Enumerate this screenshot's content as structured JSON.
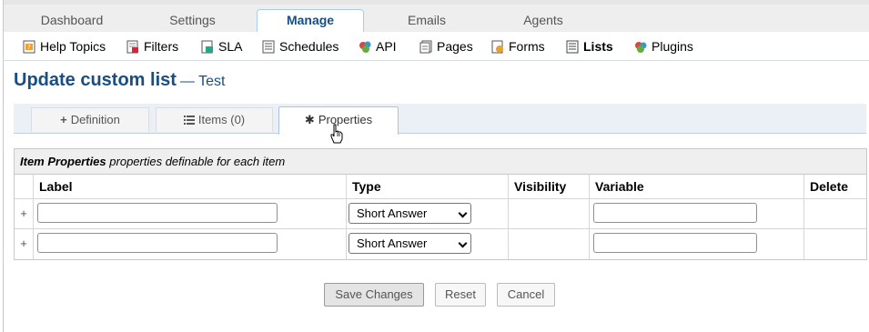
{
  "top_tabs": [
    {
      "label": "Dashboard"
    },
    {
      "label": "Settings"
    },
    {
      "label": "Manage",
      "active": true
    },
    {
      "label": "Emails"
    },
    {
      "label": "Agents"
    }
  ],
  "sub_nav": [
    {
      "label": "Help Topics",
      "icon": "help-topics-icon"
    },
    {
      "label": "Filters",
      "icon": "filters-icon"
    },
    {
      "label": "SLA",
      "icon": "sla-icon"
    },
    {
      "label": "Schedules",
      "icon": "schedules-icon"
    },
    {
      "label": "API",
      "icon": "api-icon"
    },
    {
      "label": "Pages",
      "icon": "pages-icon"
    },
    {
      "label": "Forms",
      "icon": "forms-icon"
    },
    {
      "label": "Lists",
      "icon": "lists-icon",
      "active": true
    },
    {
      "label": "Plugins",
      "icon": "plugins-icon"
    }
  ],
  "title": {
    "main": "Update custom list",
    "sub": "— Test"
  },
  "inner_tabs": [
    {
      "label": "Definition",
      "icon": "plus-icon"
    },
    {
      "label": "Items (0)",
      "icon": "list-icon"
    },
    {
      "label": "Properties",
      "icon": "asterisk-icon",
      "active": true
    }
  ],
  "table": {
    "caption_bold": "Item Properties",
    "caption_rest": "properties definable for each item",
    "headers": [
      "Label",
      "Type",
      "Visibility",
      "Variable",
      "Delete"
    ],
    "rows": [
      {
        "marker": "+",
        "label": "",
        "type": "Short Answer",
        "variable": ""
      },
      {
        "marker": "+",
        "label": "",
        "type": "Short Answer",
        "variable": ""
      }
    ]
  },
  "buttons": {
    "save": "Save Changes",
    "reset": "Reset",
    "cancel": "Cancel"
  },
  "colors": {
    "accent": "#184e81",
    "tab_border": "#aaccee",
    "inner_tab_bg": "#eaf0f5"
  }
}
